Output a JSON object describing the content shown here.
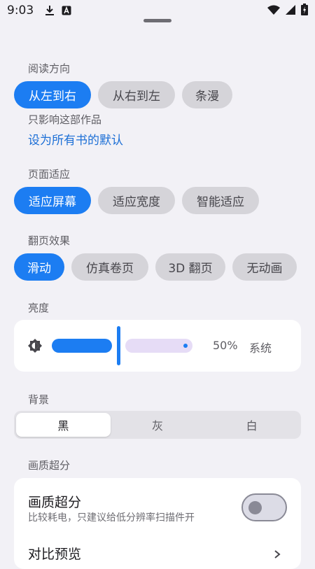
{
  "status_bar": {
    "time": "9:03",
    "icons": [
      "download-icon",
      "text-icon",
      "wifi-icon",
      "signal-icon",
      "battery-icon"
    ]
  },
  "reading_direction": {
    "label": "阅读方向",
    "options": [
      "从左到右",
      "从右到左",
      "条漫"
    ],
    "selected": "从左到右",
    "note": "只影响这部作品",
    "set_default_link": "设为所有书的默认"
  },
  "page_fit": {
    "label": "页面适应",
    "options": [
      "适应屏幕",
      "适应宽度",
      "智能适应"
    ],
    "selected": "适应屏幕"
  },
  "page_turn": {
    "label": "翻页效果",
    "options": [
      "滑动",
      "仿真卷页",
      "3D 翻页",
      "无动画"
    ],
    "selected": "滑动"
  },
  "brightness": {
    "label": "亮度",
    "value_text": "50%",
    "level": 0.5,
    "system_label": "系统"
  },
  "background": {
    "label": "背景",
    "options": [
      "黑",
      "灰",
      "白"
    ],
    "selected": "黑"
  },
  "super_resolution": {
    "section_label": "画质超分",
    "title": "画质超分",
    "description": "比较耗电，只建议给低分辨率扫描件开",
    "enabled": false,
    "compare_label": "对比预览"
  },
  "colors": {
    "accent": "#1c7df2",
    "link": "#1c6fd6",
    "background": "#f2f1f6"
  }
}
